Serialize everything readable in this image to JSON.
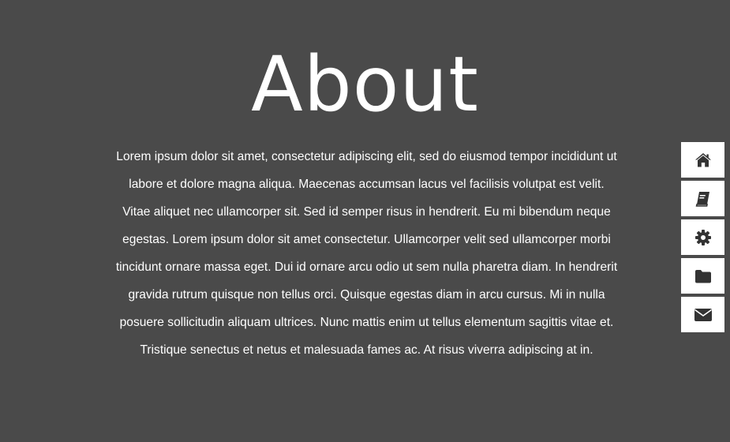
{
  "page": {
    "title": "About",
    "body": "Lorem ipsum dolor sit amet, consectetur adipiscing elit, sed do eiusmod tempor incididunt ut labore et dolore magna aliqua. Maecenas accumsan lacus vel facilisis volutpat est velit. Vitae aliquet nec ullamcorper sit. Sed id semper risus in hendrerit. Eu mi bibendum neque egestas. Lorem ipsum dolor sit amet consectetur. Ullamcorper velit sed ullamcorper morbi tincidunt ornare massa eget. Dui id ornare arcu odio ut sem nulla pharetra diam. In hendrerit gravida rutrum quisque non tellus orci. Quisque egestas diam in arcu cursus. Mi in nulla posuere sollicitudin aliquam ultrices. Nunc mattis enim ut tellus elementum sagittis vitae et. Tristique senectus et netus et malesuada fames ac. At risus viverra adipiscing at in."
  },
  "sidenav": {
    "items": [
      {
        "icon": "home-icon"
      },
      {
        "icon": "book-icon"
      },
      {
        "icon": "gear-icon"
      },
      {
        "icon": "folder-icon"
      },
      {
        "icon": "envelope-icon"
      }
    ]
  },
  "colors": {
    "background": "#4a4a4a",
    "text": "#ffffff",
    "nav_background": "#ffffff",
    "nav_icon": "#333333"
  }
}
